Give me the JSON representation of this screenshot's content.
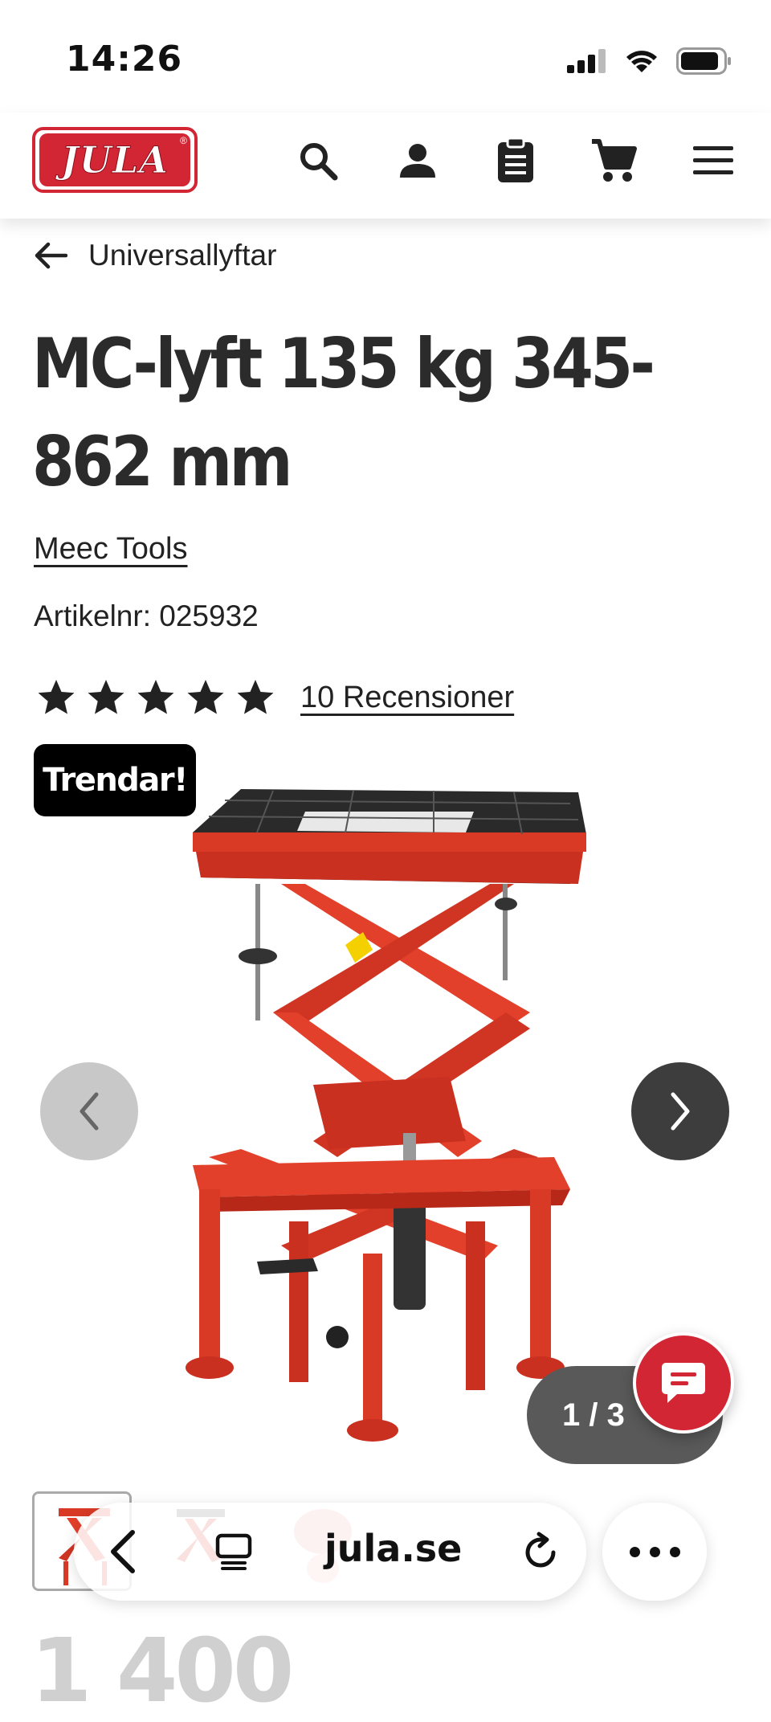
{
  "status_bar": {
    "time": "14:26"
  },
  "header": {
    "logo_text": "JULA",
    "icons": [
      "search-icon",
      "account-icon",
      "shopping-list-icon",
      "cart-icon",
      "menu-icon"
    ]
  },
  "breadcrumb": {
    "label": "Universallyftar"
  },
  "product": {
    "title": "MC-lyft 135 kg 345-862 mm",
    "brand": "Meec Tools",
    "article_number": "Artikelnr: 025932",
    "rating": 5,
    "reviews_label": "10 Recensioner",
    "badge": "Trendar!",
    "price_partial": "1 400"
  },
  "gallery": {
    "counter": "1 / 3"
  },
  "browser": {
    "url": "jula.se"
  },
  "colors": {
    "brand_red": "#d32635",
    "lift_red": "#e23a24",
    "badge_bg": "#000000"
  }
}
